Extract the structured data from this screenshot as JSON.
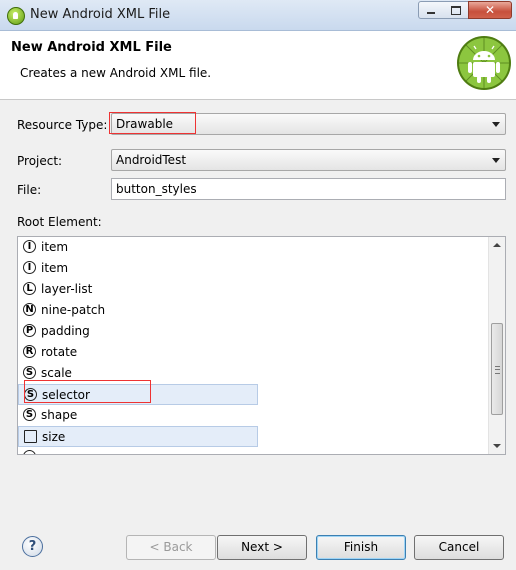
{
  "window": {
    "title": "New Android XML File",
    "icon": "android-app-icon"
  },
  "header": {
    "title": "New Android XML File",
    "description": "Creates a new Android XML file.",
    "logo_icon": "android-robot-icon"
  },
  "form": {
    "resource_type_label": "Resource Type:",
    "resource_type_value": "Drawable",
    "project_label": "Project:",
    "project_value": "AndroidTest",
    "file_label": "File:",
    "file_value": "button_styles",
    "root_element_label": "Root Element:"
  },
  "root_elements": [
    {
      "letter": "I",
      "label": "item"
    },
    {
      "letter": "I",
      "label": "item"
    },
    {
      "letter": "L",
      "label": "layer-list"
    },
    {
      "letter": "N",
      "label": "nine-patch"
    },
    {
      "letter": "P",
      "label": "padding"
    },
    {
      "letter": "R",
      "label": "rotate"
    },
    {
      "letter": "S",
      "label": "scale"
    },
    {
      "letter": "S",
      "label": "selector"
    },
    {
      "letter": "S",
      "label": "shape"
    },
    {
      "letter": "",
      "label": "size"
    }
  ],
  "buttons": {
    "back": "< Back",
    "next": "Next >",
    "finish": "Finish",
    "cancel": "Cancel",
    "help": "?"
  },
  "colors": {
    "highlight_box": "#e33333",
    "selection_bg": "#e4edf9"
  }
}
